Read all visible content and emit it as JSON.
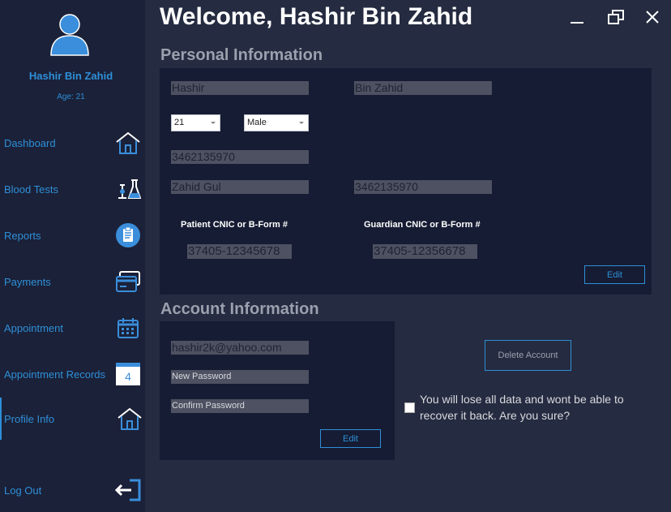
{
  "header": {
    "title": "Welcome, Hashir Bin Zahid"
  },
  "window_controls": {
    "minimize": "minimize-icon",
    "restore": "restore-icon",
    "close": "close-icon"
  },
  "profile": {
    "name": "Hashir Bin Zahid",
    "age": "Age: 21"
  },
  "sidebar": {
    "items": [
      {
        "label": "Dashboard",
        "icon": "home-icon"
      },
      {
        "label": "Blood Tests",
        "icon": "lab-flask-icon"
      },
      {
        "label": "Reports",
        "icon": "clipboard-icon"
      },
      {
        "label": "Payments",
        "icon": "credit-card-icon"
      },
      {
        "label": "Appointment",
        "icon": "calendar-icon"
      },
      {
        "label": "Appointment Records",
        "icon": "calendar-day-icon",
        "badge": "4"
      },
      {
        "label": "Profile Info",
        "icon": "home-icon",
        "active": true
      },
      {
        "label": "Log Out",
        "icon": "logout-icon"
      }
    ]
  },
  "personal": {
    "section_title": "Personal Information",
    "first_name": "Hashir",
    "last_name": "Bin Zahid",
    "age": "21",
    "gender": "Male",
    "phone": "3462135970",
    "guardian_name": "Zahid Gul",
    "guardian_phone": "3462135970",
    "patient_cnic_label": "Patient CNIC or B-Form #",
    "guardian_cnic_label": "Guardian CNIC or B-Form #",
    "patient_cnic": "37405-12345678",
    "guardian_cnic": "37405-12356678",
    "edit_label": "Edit"
  },
  "account": {
    "section_title": "Account Information",
    "email": "hashir2k@yahoo.com",
    "new_password_placeholder": "New Password",
    "confirm_password_placeholder": "Confirm Password",
    "edit_label": "Edit",
    "delete_label": "Delete Account",
    "delete_confirm_text": "You will lose all data and wont be able to recover it back. Are you sure?"
  },
  "colors": {
    "accent": "#2e8fd8",
    "sidebar_bg": "#1b2138",
    "main_bg": "#252b40",
    "panel_bg": "#161c33",
    "field_bg": "#4d5161"
  }
}
